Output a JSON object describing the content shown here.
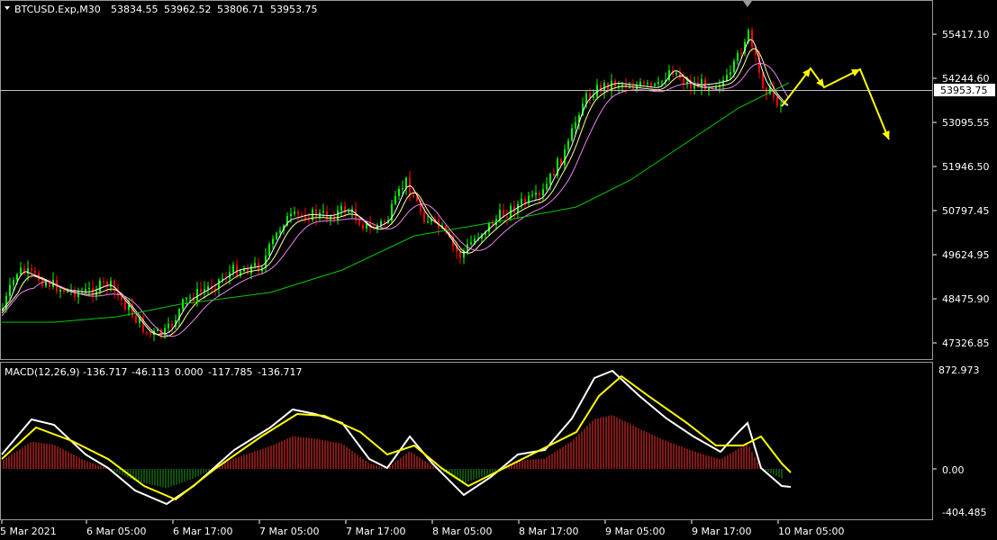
{
  "main_panel": {
    "header": {
      "symbol": "BTCUSD.Exp,M30",
      "open": "53834.55",
      "high": "53962.52",
      "low": "53806.71",
      "close": "53953.75"
    },
    "price_labels": [
      "55417.10",
      "54244.60",
      "53095.55",
      "51946.50",
      "50797.45",
      "49624.95",
      "48475.90",
      "47326.85"
    ],
    "current_price": "53953.75",
    "colors": {
      "bull_candle": "#00ff00",
      "bear_candle": "#ff0000",
      "ma_fast": "#ffffff",
      "ma_mid": "#ffff99",
      "ma_slow": "#ee82ee",
      "ma_long": "#00cc00",
      "forecast_arrows": "#ffff00"
    }
  },
  "macd_panel": {
    "header": {
      "name": "MACD(12,26,9)",
      "v1": "-136.717",
      "v2": "-46.113",
      "v3": "0.000",
      "v4": "-117.785",
      "v5": "-136.717"
    },
    "scale_labels": [
      "872.973",
      "0.00",
      "-404.485"
    ],
    "colors": {
      "macd_line": "#ffffff",
      "signal_line": "#ffff00",
      "hist_pos": "#ff3030",
      "hist_neg": "#1f9d1f"
    }
  },
  "time_axis": [
    "5 Mar 2021",
    "6 Mar 05:00",
    "6 Mar 17:00",
    "7 Mar 05:00",
    "7 Mar 17:00",
    "8 Mar 05:00",
    "8 Mar 17:00",
    "9 Mar 05:00",
    "9 Mar 17:00",
    "10 Mar 05:00"
  ]
}
